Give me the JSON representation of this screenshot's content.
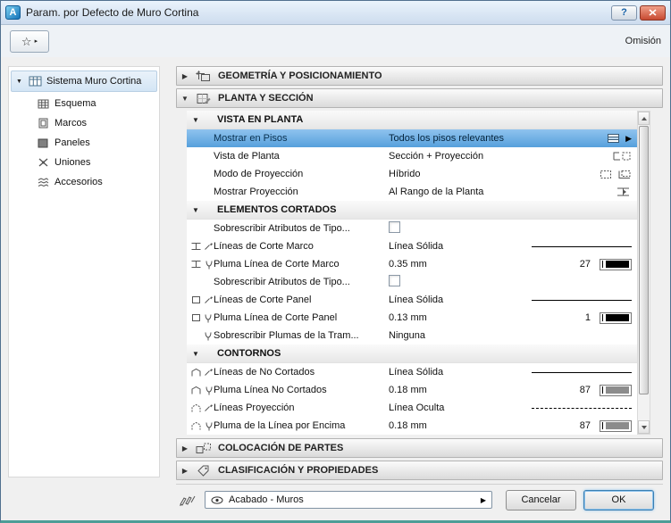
{
  "window": {
    "title": "Param. por Defecto de Muro Cortina"
  },
  "icons": {
    "app": "A",
    "help": "?",
    "star": "☆",
    "fav_arrow": "▸",
    "tree_expander": "▼",
    "collapsed": "▶",
    "expanded": "▼",
    "popup": "▶",
    "dd_arrow": "▶"
  },
  "toolbar": {
    "omission_label": "Omisión"
  },
  "sidebar": {
    "root_label": "Sistema Muro Cortina",
    "items": [
      {
        "label": "Esquema"
      },
      {
        "label": "Marcos"
      },
      {
        "label": "Paneles"
      },
      {
        "label": "Uniones"
      },
      {
        "label": "Accesorios"
      }
    ]
  },
  "accordions": {
    "geometry_label": "GEOMETRÍA Y POSICIONAMIENTO",
    "plan_label": "PLANTA Y SECCIÓN",
    "placement_label": "COLOCACIÓN DE PARTES",
    "classification_label": "CLASIFICACIÓN Y PROPIEDADES"
  },
  "plan": {
    "vista": {
      "title": "VISTA EN PLANTA",
      "mostrar_pisos": {
        "label": "Mostrar en Pisos",
        "value": "Todos los pisos relevantes"
      },
      "vista_planta": {
        "label": "Vista de Planta",
        "value": "Sección + Proyección"
      },
      "modo_proyeccion": {
        "label": "Modo de Proyección",
        "value": "Híbrido"
      },
      "mostrar_proyeccion": {
        "label": "Mostrar Proyección",
        "value": "Al Rango de la Planta"
      }
    },
    "cortados": {
      "title": "ELEMENTOS CORTADOS",
      "sobrescribir_marco": {
        "label": "Sobrescribir Atributos de Tipo...",
        "checked": false
      },
      "lineas_corte_marco": {
        "label": "Líneas de Corte Marco",
        "value": "Línea Sólida"
      },
      "pluma_corte_marco": {
        "label": "Pluma Línea de Corte Marco",
        "value": "0.35 mm",
        "pen": "27"
      },
      "sobrescribir_panel": {
        "label": "Sobrescribir Atributos de Tipo...",
        "checked": false
      },
      "lineas_corte_panel": {
        "label": "Líneas de Corte Panel",
        "value": "Línea Sólida"
      },
      "pluma_corte_panel": {
        "label": "Pluma Línea de Corte Panel",
        "value": "0.13 mm",
        "pen": "1"
      },
      "sobrescribir_plumas": {
        "label": "Sobrescribir Plumas de la Tram...",
        "value": "Ninguna"
      }
    },
    "contornos": {
      "title": "CONTORNOS",
      "lineas_no_cortados": {
        "label": "Líneas de No Cortados",
        "value": "Línea Sólida"
      },
      "pluma_no_cortados": {
        "label": "Pluma Línea No Cortados",
        "value": "0.18 mm",
        "pen": "87"
      },
      "lineas_proyeccion": {
        "label": "Líneas Proyección",
        "value": "Línea Oculta"
      },
      "pluma_por_encima": {
        "label": "Pluma de la Línea por Encima",
        "value": "0.18 mm",
        "pen": "87"
      }
    }
  },
  "footer": {
    "pen_set_value": "Acabado - Muros",
    "cancel_label": "Cancelar",
    "ok_label": "OK"
  },
  "colors": {
    "selection_blue": "#56a0dc",
    "pen_black": "#000000",
    "pen_gray": "#8c8c8c"
  }
}
